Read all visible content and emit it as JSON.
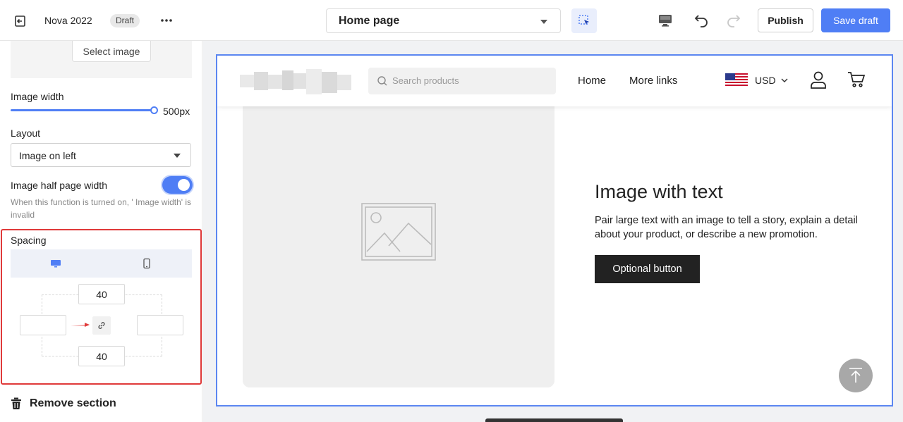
{
  "topbar": {
    "title": "Nova 2022",
    "badge": "Draft",
    "page_select": "Home page",
    "publish_label": "Publish",
    "save_label": "Save draft"
  },
  "sidebar": {
    "select_image_label": "Select image",
    "image_width_label": "Image width",
    "image_width_value": "500px",
    "layout_label": "Layout",
    "layout_value": "Image on left",
    "half_width_label": "Image half page width",
    "half_width_hint": "When this function is turned on, ' Image width' is invalid",
    "spacing_label": "Spacing",
    "spacing_top": "40",
    "spacing_left": "",
    "spacing_right": "",
    "spacing_bottom": "40",
    "remove_label": "Remove section"
  },
  "preview": {
    "search_placeholder": "Search products",
    "nav_home": "Home",
    "nav_more": "More links",
    "currency": "USD",
    "heading": "Image with text",
    "body": "Pair large text with an image to tell a story, explain a detail about your product, or describe a new promotion.",
    "button_label": "Optional button"
  },
  "colors": {
    "accent": "#4f7ef5",
    "highlight_border": "#e03a3a",
    "dark_button": "#222222"
  }
}
